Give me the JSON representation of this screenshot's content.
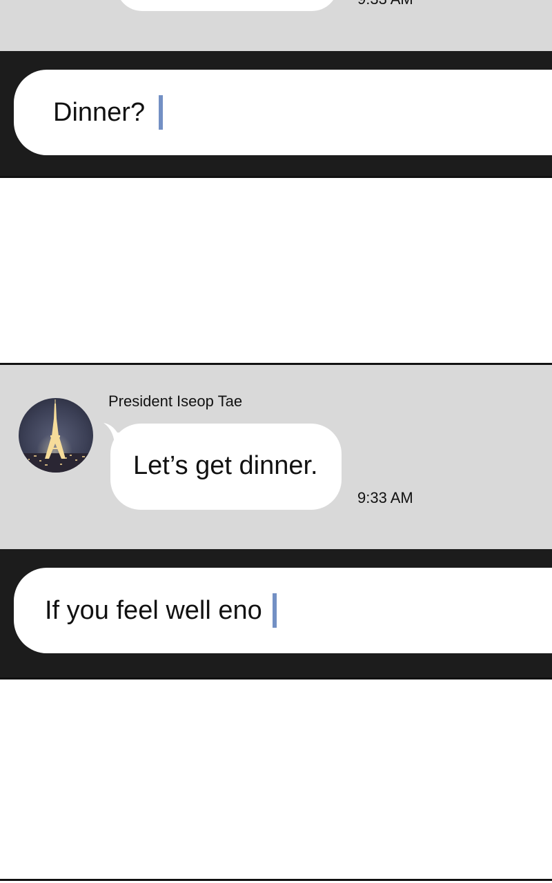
{
  "panel_top": {
    "timestamp": "9:33 AM"
  },
  "input_one": {
    "value": "Dinner?"
  },
  "chat": {
    "sender_name": "President Iseop Tae",
    "message": "Let’s get dinner.",
    "timestamp": "9:33 AM",
    "avatar_icon": "eiffel-tower-night-avatar"
  },
  "input_two": {
    "value": "If you feel well eno"
  },
  "colors": {
    "chat_bg": "#d9d9d9",
    "input_bar_bg": "#1c1c1c",
    "caret": "#7390c4",
    "bubble": "#ffffff"
  }
}
